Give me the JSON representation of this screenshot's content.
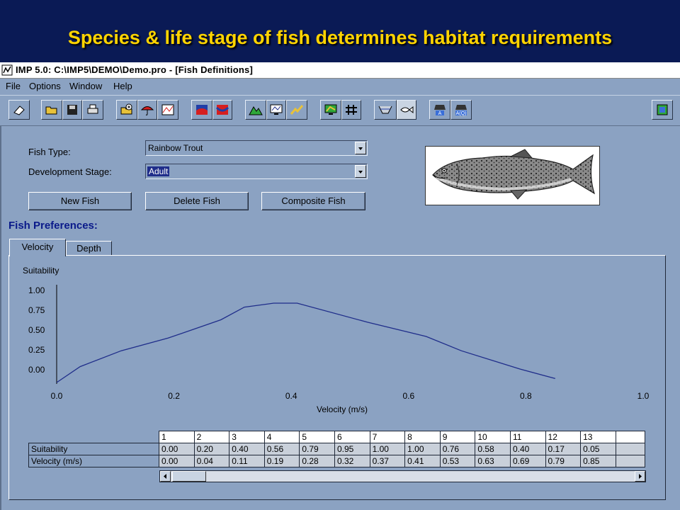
{
  "slide": {
    "title": "Species & life stage of fish determines habitat requirements"
  },
  "window": {
    "title": "IMP 5.0: C:\\IMP5\\DEMO\\Demo.pro - [Fish Definitions]"
  },
  "menu": [
    "File",
    "Options",
    "Window",
    "Help"
  ],
  "form": {
    "fish_type_label": "Fish Type:",
    "fish_type_value": "Rainbow Trout",
    "stage_label": "Development Stage:",
    "stage_value": "Adult",
    "new_fish": "New Fish",
    "delete_fish": "Delete Fish",
    "composite_fish": "Composite Fish"
  },
  "prefs": {
    "title": "Fish Preferences:",
    "tabs": [
      "Velocity",
      "Depth"
    ]
  },
  "chart_data": {
    "type": "line",
    "ylabel": "Suitability",
    "xlabel": "Velocity (m/s)",
    "xlim": [
      0.0,
      1.0
    ],
    "ylim": [
      0.0,
      1.0
    ],
    "x_ticks": [
      "0.0",
      "0.2",
      "0.4",
      "0.6",
      "0.8",
      "1.0"
    ],
    "y_ticks": [
      "1.00",
      "0.75",
      "0.50",
      "0.25",
      "0.00"
    ],
    "x": [
      0.0,
      0.04,
      0.11,
      0.19,
      0.28,
      0.32,
      0.37,
      0.41,
      0.53,
      0.63,
      0.69,
      0.79,
      0.85
    ],
    "y": [
      0.0,
      0.2,
      0.4,
      0.56,
      0.79,
      0.95,
      1.0,
      1.0,
      0.76,
      0.58,
      0.4,
      0.17,
      0.05
    ],
    "line_color": "#1f2d8a"
  },
  "grid": {
    "row_headers": [
      "Suitability",
      "Velocity (m/s)"
    ],
    "columns": [
      "1",
      "2",
      "3",
      "4",
      "5",
      "6",
      "7",
      "8",
      "9",
      "10",
      "11",
      "12",
      "13"
    ],
    "suitability": [
      "0.00",
      "0.20",
      "0.40",
      "0.56",
      "0.79",
      "0.95",
      "1.00",
      "1.00",
      "0.76",
      "0.58",
      "0.40",
      "0.17",
      "0.05"
    ],
    "velocity": [
      "0.00",
      "0.04",
      "0.11",
      "0.19",
      "0.28",
      "0.32",
      "0.37",
      "0.41",
      "0.53",
      "0.63",
      "0.69",
      "0.79",
      "0.85"
    ]
  }
}
